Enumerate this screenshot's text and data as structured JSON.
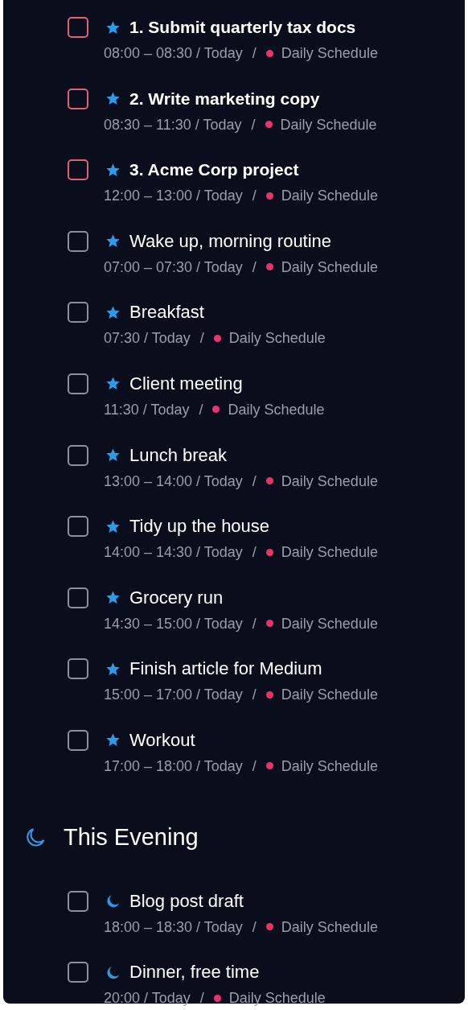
{
  "tasks": [
    {
      "title": "1. Submit quarterly tax docs",
      "priority": true,
      "checkbox": {
        "color": "#e06270"
      },
      "kind": "star",
      "when": "08:00 – 08:30 / Today",
      "sep": "/",
      "list": "Daily Schedule",
      "color": "#e8336b"
    },
    {
      "title": "2. Write marketing copy",
      "priority": true,
      "checkbox": {
        "color": "#e06270"
      },
      "kind": "star",
      "when": "08:30 – 11:30 / Today",
      "sep": "/",
      "list": "Daily Schedule",
      "color": "#e8336b"
    },
    {
      "title": "3. Acme Corp project",
      "priority": true,
      "checkbox": {
        "color": "#e06270"
      },
      "kind": "star",
      "when": "12:00 – 13:00 / Today",
      "sep": "/",
      "list": "Daily Schedule",
      "color": "#e8336b"
    },
    {
      "title": "Wake up, morning routine",
      "priority": false,
      "checkbox": {
        "color": "#8d909c"
      },
      "kind": "star",
      "when": "07:00 – 07:30 / Today",
      "sep": "/",
      "list": "Daily Schedule",
      "color": "#e8336b"
    },
    {
      "title": "Breakfast",
      "priority": false,
      "checkbox": {
        "color": "#8d909c"
      },
      "kind": "star",
      "when": "07:30 / Today",
      "sep": "/",
      "list": "Daily Schedule",
      "color": "#e8336b"
    },
    {
      "title": "Client meeting",
      "priority": false,
      "checkbox": {
        "color": "#8d909c"
      },
      "kind": "star",
      "when": "11:30 / Today",
      "sep": "/",
      "list": "Daily Schedule",
      "color": "#e8336b"
    },
    {
      "title": "Lunch break",
      "priority": false,
      "checkbox": {
        "color": "#8d909c"
      },
      "kind": "star",
      "when": "13:00 – 14:00 / Today",
      "sep": "/",
      "list": "Daily Schedule",
      "color": "#e8336b"
    },
    {
      "title": "Tidy up the house",
      "priority": false,
      "checkbox": {
        "color": "#8d909c"
      },
      "kind": "star",
      "when": "14:00 – 14:30 / Today",
      "sep": "/",
      "list": "Daily Schedule",
      "color": "#e8336b"
    },
    {
      "title": "Grocery run",
      "priority": false,
      "checkbox": {
        "color": "#8d909c"
      },
      "kind": "star",
      "when": "14:30 – 15:00 / Today",
      "sep": "/",
      "list": "Daily Schedule",
      "color": "#e8336b"
    },
    {
      "title": "Finish article for Medium",
      "priority": false,
      "checkbox": {
        "color": "#8d909c"
      },
      "kind": "star",
      "when": "15:00 – 17:00 / Today",
      "sep": "/",
      "list": "Daily Schedule",
      "color": "#e8336b"
    },
    {
      "title": "Workout",
      "priority": false,
      "checkbox": {
        "color": "#8d909c"
      },
      "kind": "star",
      "when": "17:00 – 18:00 / Today",
      "sep": "/",
      "list": "Daily Schedule",
      "color": "#e8336b"
    }
  ],
  "sections": [
    {
      "title": "This Evening",
      "tasks": [
        {
          "title": "Blog post draft",
          "priority": false,
          "checkbox": {
            "color": "#8d909c"
          },
          "kind": "moon",
          "when": "18:00 – 18:30 / Today",
          "sep": "/",
          "list": "Daily Schedule",
          "color": "#e8336b"
        },
        {
          "title": "Dinner, free time",
          "priority": false,
          "checkbox": {
            "color": "#8d909c"
          },
          "kind": "moon",
          "when": "20:00 / Today",
          "sep": "/",
          "list": "Daily Schedule",
          "color": "#e8336b"
        }
      ]
    }
  ]
}
